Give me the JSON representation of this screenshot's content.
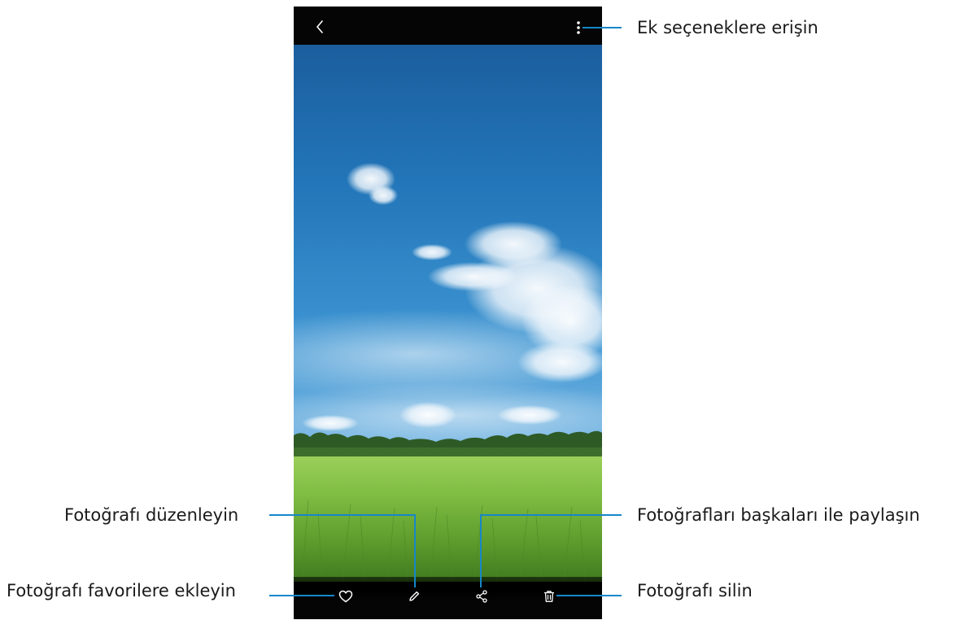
{
  "viewer": {
    "back_icon": "chevron-left-icon",
    "more_icon": "more-vertical-icon",
    "bottom_icons": [
      "heart-icon",
      "pencil-icon",
      "share-icon",
      "trash-icon"
    ]
  },
  "callouts": {
    "more_options": "Ek seçeneklere erişin",
    "edit": "Fotoğrafı düzenleyin",
    "share": "Fotoğrafları başkaları ile paylaşın",
    "favorite": "Fotoğrafı favorilere ekleyin",
    "delete": "Fotoğrafı silin"
  },
  "colors": {
    "leader_line": "#1687c9",
    "bar_background": "#050505",
    "icon": "#ffffff"
  }
}
